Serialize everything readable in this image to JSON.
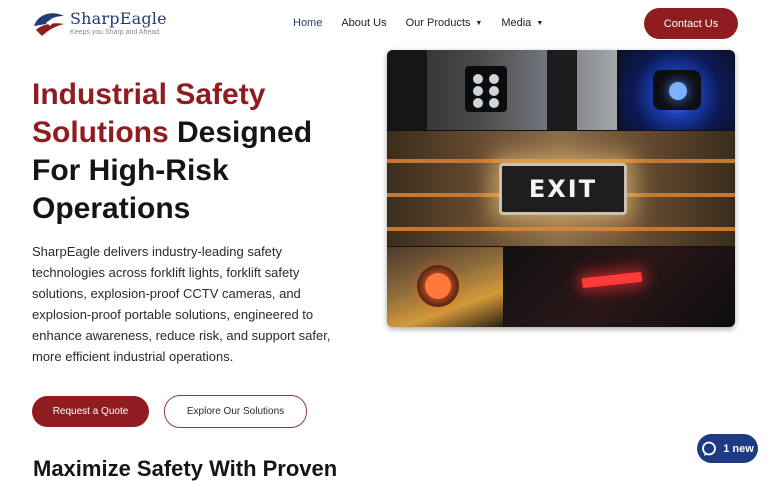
{
  "brand": {
    "name": "SharpEagle",
    "tagline": "Keeps you Sharp and Ahead",
    "colors": {
      "primary": "#8f1d20",
      "navy": "#233a73"
    }
  },
  "nav": {
    "items": [
      {
        "label": "Home",
        "active": true
      },
      {
        "label": "About Us"
      },
      {
        "label": "Our Products",
        "has_dropdown": true
      },
      {
        "label": "Media",
        "has_dropdown": true
      }
    ],
    "contact_label": "Contact Us"
  },
  "hero": {
    "title_red_1": "Industrial Safety",
    "title_red_2": "Solutions",
    "title_dark_1": " Designed",
    "title_dark_2": "For High-Risk",
    "title_dark_3": "Operations",
    "description": "SharpEagle delivers industry-leading safety technologies across forklift lights, forklift safety solutions, explosion-proof CCTV cameras, and explosion-proof portable solutions, engineered to enhance awareness, reduce risk, and support safer, more efficient industrial operations.",
    "cta_primary": "Request a Quote",
    "cta_secondary": "Explore Our Solutions"
  },
  "collage": {
    "exit_sign_text": "EXIT",
    "tiles": [
      "forklift-light",
      "blue-spot-light",
      "exit-sign",
      "orange-warning-light",
      "red-zone-light"
    ]
  },
  "next_section": {
    "heading": "Maximize Safety With Proven"
  },
  "chat": {
    "label": "1 new",
    "icon": "chat-bubble-icon"
  }
}
